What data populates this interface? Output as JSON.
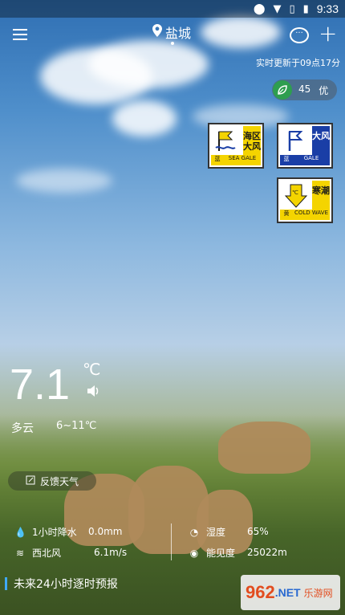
{
  "status": {
    "time": "9:33"
  },
  "header": {
    "city": "盐城"
  },
  "update_text": "实时更新于09点17分",
  "aqi": {
    "value": "45",
    "level": "优"
  },
  "warnings": [
    {
      "name": "海区大风",
      "level": "蓝",
      "en": "SEA GALE",
      "color": "#1a3ea6"
    },
    {
      "name": "大风",
      "level": "蓝",
      "en": "GALE",
      "color": "#1a3ea6"
    },
    {
      "name": "寒潮",
      "level": "黄",
      "en": "COLD WAVE",
      "color": "#f4d400"
    }
  ],
  "current": {
    "temperature": "7.1",
    "unit": "℃",
    "condition": "多云",
    "range": "6~11℃"
  },
  "feedback_label": "反馈天气",
  "metrics": {
    "precip_label": "1小时降水",
    "precip_value": "0.0mm",
    "humidity_label": "湿度",
    "humidity_value": "65%",
    "wind_label": "西北风",
    "wind_value": "6.1m/s",
    "visibility_label": "能见度",
    "visibility_value": "25022m"
  },
  "forecast_title": "未来24小时逐时预报",
  "watermark": {
    "number": "962",
    "suffix": ".NET",
    "text": "乐游网"
  }
}
